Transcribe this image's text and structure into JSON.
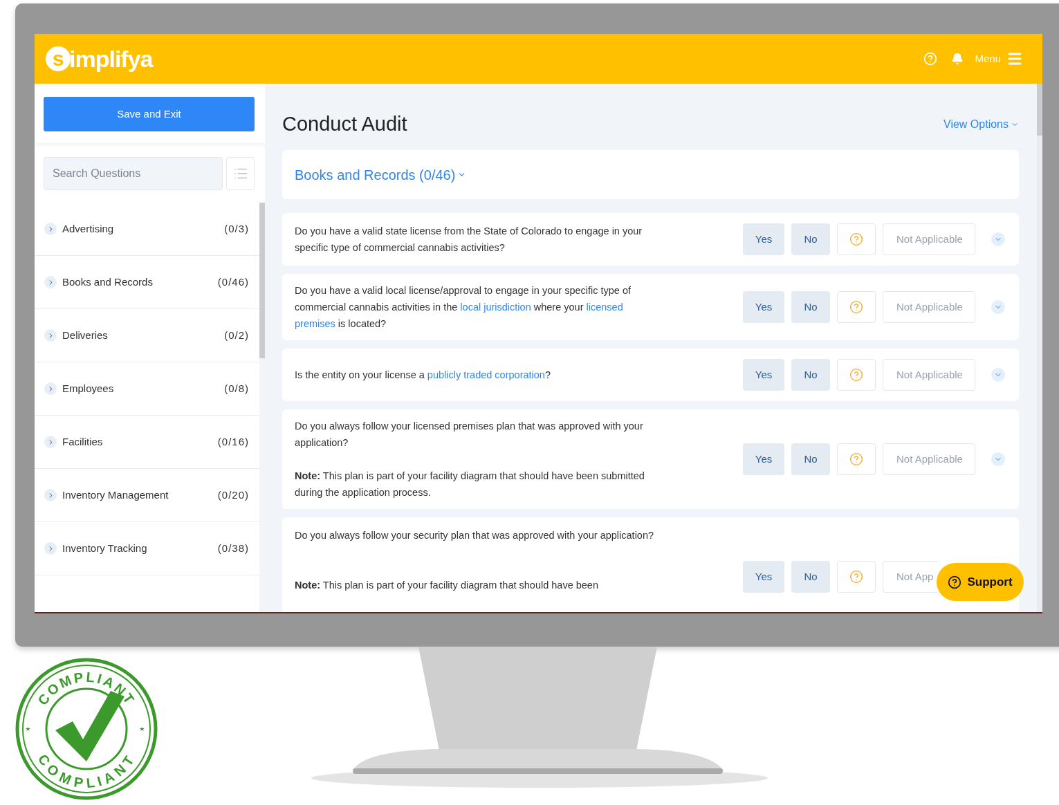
{
  "header": {
    "logo": "simplifya",
    "menu_label": "Menu"
  },
  "sidebar": {
    "save_button": "Save and Exit",
    "search": {
      "placeholder": "Search Questions"
    },
    "items": [
      {
        "name": "Advertising",
        "count": "(0/3)",
        "expanded": false
      },
      {
        "name": "Books and Records",
        "count": "(0/46)",
        "expanded": false
      },
      {
        "name": "Deliveries",
        "count": "(0/2)",
        "expanded": false
      },
      {
        "name": "Employees",
        "count": "(0/8)",
        "expanded": false
      },
      {
        "name": "Facilities",
        "count": "(0/16)",
        "expanded": false
      },
      {
        "name": "Inventory Management",
        "count": "(0/20)",
        "expanded": false
      },
      {
        "name": "Inventory Tracking",
        "count": "(0/38)",
        "expanded": false
      }
    ]
  },
  "main": {
    "title": "Conduct Audit",
    "view_options": "View Options",
    "section": "Books and Records (0/46)",
    "questions": [
      {
        "text": [
          {
            "kind": "plain",
            "text": "Do you have a valid state license from the State of Colorado to engage in your specific type of commercial cannabis activities?"
          }
        ],
        "options": [
          "Yes",
          "No",
          "Not Applicable"
        ]
      },
      {
        "text": [
          {
            "kind": "plain",
            "text": "Do you have a valid local license/approval to engage in your specific type of commercial cannabis activities in the "
          },
          {
            "kind": "link",
            "text": "local jurisdiction"
          },
          {
            "kind": "plain",
            "text": " where your "
          },
          {
            "kind": "link",
            "text": "licensed"
          },
          {
            "kind": "link",
            "text": "premises"
          },
          {
            "kind": "plain",
            "text": " is located?"
          }
        ],
        "options": [
          "Yes",
          "No",
          "Not Applicable"
        ]
      },
      {
        "text": [
          {
            "kind": "plain",
            "text": "Is the entity on your license a "
          },
          {
            "kind": "link",
            "text": "publicly traded corporation"
          },
          {
            "kind": "plain",
            "text": "?"
          }
        ],
        "options": [
          "Yes",
          "No",
          "Not Applicable"
        ]
      },
      {
        "text": [
          {
            "kind": "plain",
            "text": "Do you always follow your licensed premises plan that was approved with your application?"
          }
        ],
        "note": "**Note:** This plan is part of your facility diagram that should have been submitted during the application process.",
        "options": [
          "Yes",
          "No",
          "Not Applicable"
        ]
      },
      {
        "text": [
          {
            "kind": "plain",
            "text": "Do you always follow your security plan that was approved with your application?"
          }
        ],
        "note": "**Note:** This plan is part of your facility diagram that should have been",
        "options": [
          "Yes",
          "No",
          "Not App"
        ],
        "tall": true
      }
    ],
    "support_button": "Support"
  },
  "stamp": {
    "top_text": "COMPLIANT",
    "bottom_text": "COMPLIANT"
  }
}
